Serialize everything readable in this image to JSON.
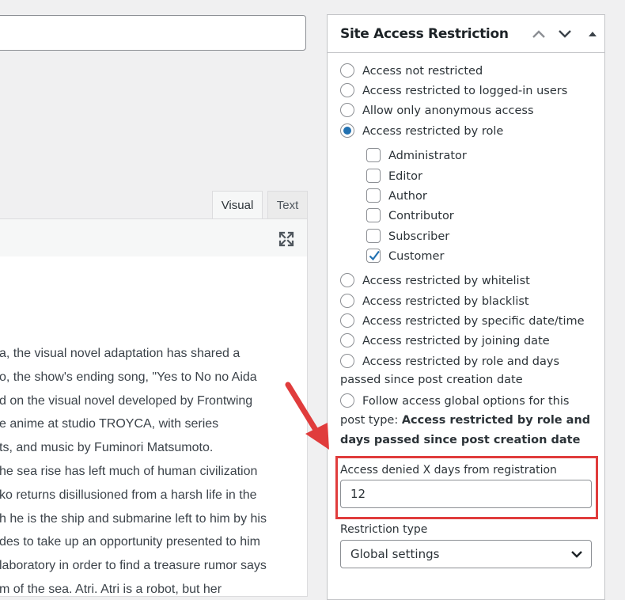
{
  "editor": {
    "tabs": {
      "visual": "Visual",
      "text": "Text"
    },
    "lines": [
      "a, the visual novel adaptation has shared a",
      "o, the show's ending song, \"Yes to No no Aida",
      "d on the visual novel developed by Frontwing",
      "e anime at studio TROYCA, with series",
      "ts, and music by Fuminori Matsumoto.",
      "he sea rise has left much of human civilization",
      "ko returns disillusioned from a harsh life in the",
      "h he is the ship and submarine left to him by his",
      "des to take up an opportunity presented to him",
      "laboratory in order to find a treasure rumor says",
      "m of the sea. Atri. Atri is a robot, but her"
    ]
  },
  "metabox": {
    "title": "Site Access Restriction",
    "options": {
      "not_restricted": "Access not restricted",
      "logged_in": "Access restricted to logged-in users",
      "anonymous": "Allow only anonymous access",
      "by_role": "Access restricted by role",
      "whitelist": "Access restricted by whitelist",
      "blacklist": "Access restricted by blacklist",
      "date_time": "Access restricted by specific date/time",
      "joining_date": "Access restricted by joining date",
      "role_days_1": "Access restricted by role and days",
      "role_days_2": "passed since post creation date",
      "global_1": "Follow access global options for this",
      "global_2_prefix": "post type: ",
      "global_2_bold": "Access restricted by role and",
      "global_3_bold": "days passed since post creation date"
    },
    "selected_option": "by_role",
    "roles": [
      {
        "label": "Administrator",
        "checked": false
      },
      {
        "label": "Editor",
        "checked": false
      },
      {
        "label": "Author",
        "checked": false
      },
      {
        "label": "Contributor",
        "checked": false
      },
      {
        "label": "Subscriber",
        "checked": false
      },
      {
        "label": "Customer",
        "checked": true
      }
    ],
    "days_field": {
      "label": "Access denied X days from registration",
      "value": "12"
    },
    "restriction_type": {
      "label": "Restriction type",
      "selected": "Global settings"
    }
  },
  "colors": {
    "accent": "#2271b1",
    "highlight": "#e03c3c"
  }
}
